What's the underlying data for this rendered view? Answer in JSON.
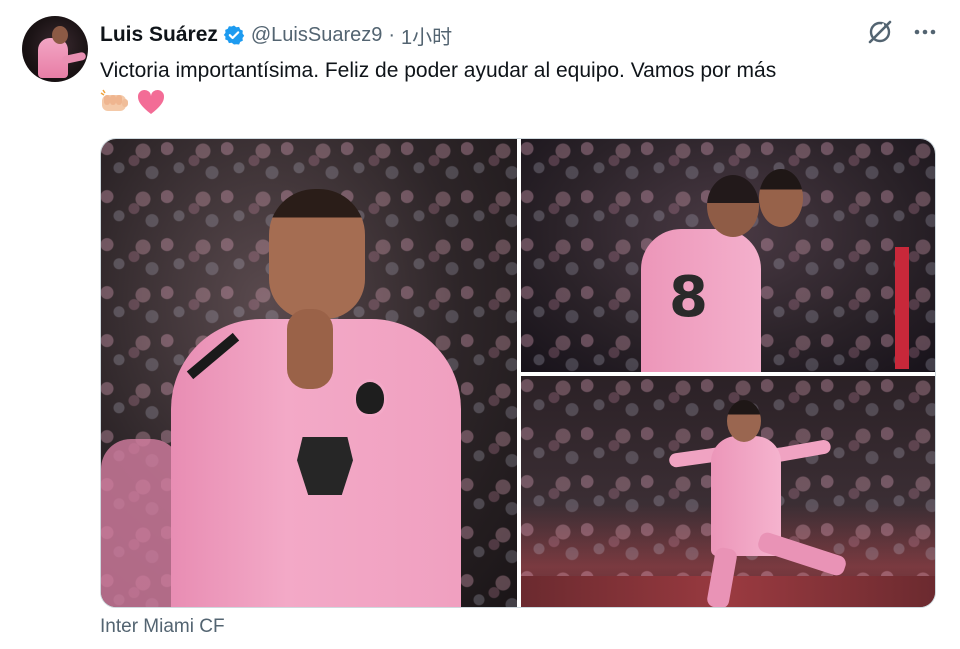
{
  "author": {
    "display_name": "Luis Suárez",
    "handle": "@LuisSuarez9",
    "separator": "·",
    "time": "1小时",
    "verified": true,
    "verified_color": "#1d9bf0"
  },
  "tweet": {
    "text": "Victoria importantísima. Feliz de poder ayudar al equipo. Vamos por más",
    "emojis": [
      "fist-bump-emoji",
      "pink-heart-emoji"
    ]
  },
  "media": {
    "count": 3,
    "player2_number": "8",
    "caption": "Inter Miami CF"
  },
  "actions": {
    "grok_icon": "grok-icon",
    "more_icon": "more-options-icon"
  },
  "colors": {
    "text_primary": "#0f1419",
    "text_secondary": "#536471",
    "jersey_pink": "#f3a9c7",
    "heart_pink": "#f36c96"
  }
}
